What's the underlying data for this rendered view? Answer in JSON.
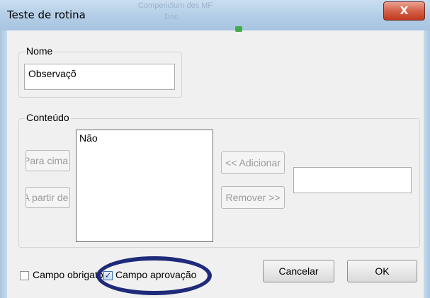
{
  "window": {
    "title": "Teste de rotina",
    "close_label": "X"
  },
  "nome": {
    "legend": "Nome",
    "value": "Observaçõ"
  },
  "conteudo": {
    "legend": "Conteúdo",
    "para_cima_label": "Para cima",
    "a_partir_label": "A partir de",
    "list_items": [
      "Não"
    ],
    "adicionar_label": "<< Adicionar",
    "remover_label": "Remover >>",
    "new_item_value": ""
  },
  "footer": {
    "campo_obrigatorio_label": "Campo obrigatório",
    "campo_aprovacao_label": "Campo aprovação",
    "campo_obrigatorio_checked": false,
    "campo_aprovacao_checked": true,
    "cancelar_label": "Cancelar",
    "ok_label": "OK"
  }
}
